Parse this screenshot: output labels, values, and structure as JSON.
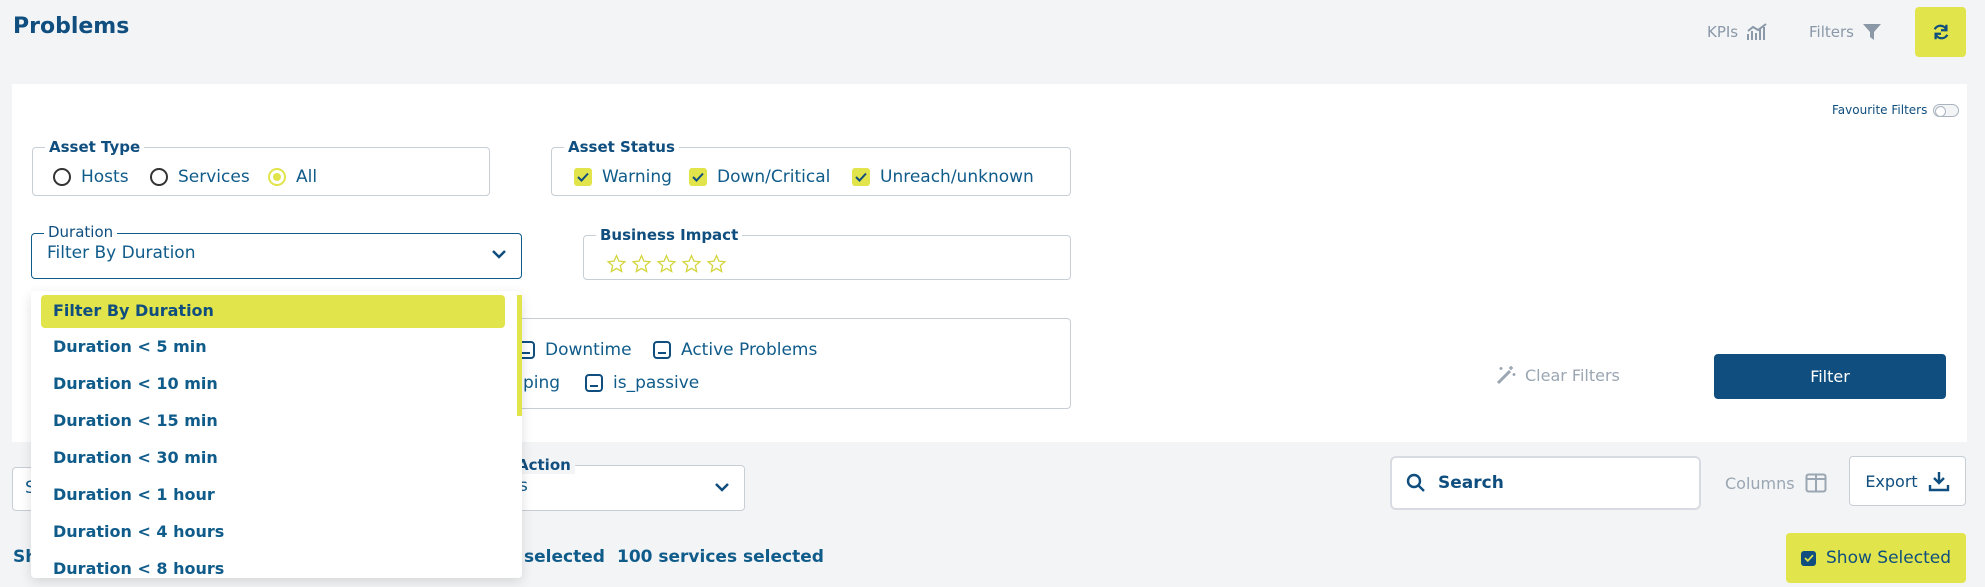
{
  "header": {
    "title": "Problems",
    "kpis_label": "KPIs",
    "filters_label": "Filters"
  },
  "panel": {
    "favourite_filters_label": "Favourite Filters",
    "asset_type": {
      "legend": "Asset Type",
      "options": [
        "Hosts",
        "Services",
        "All"
      ],
      "selected": "All"
    },
    "asset_status": {
      "legend": "Asset Status",
      "options": [
        "Warning",
        "Down/Critical",
        "Unreach/unknown"
      ]
    },
    "duration": {
      "label": "Duration",
      "value": "Filter By Duration"
    },
    "business_impact": {
      "legend": "Business Impact",
      "stars": 5
    },
    "checks": {
      "row1": [
        "Downtime",
        "Active Problems"
      ],
      "row2_partial": "ping",
      "row2": [
        "is_passive"
      ]
    },
    "clear_filters_label": "Clear Filters",
    "filter_button_label": "Filter"
  },
  "toolbar": {
    "left_select_partial": "S",
    "action": {
      "label": "Action",
      "value_partial": "s"
    },
    "search_placeholder": "Search",
    "columns_label": "Columns",
    "export_label": "Export"
  },
  "footer": {
    "show_partial": "Sh",
    "hosts_selected_partial": "selected",
    "services_selected": "100 services selected",
    "show_selected_label": "Show Selected"
  },
  "dropdown": {
    "items": [
      "Filter By Duration",
      "Duration < 5 min",
      "Duration < 10 min",
      "Duration < 15 min",
      "Duration < 30 min",
      "Duration < 1 hour",
      "Duration < 4 hours",
      "Duration < 8 hours"
    ],
    "selected_index": 0
  },
  "colors": {
    "accent": "#e1e44a",
    "primary": "#0f4e7e",
    "text": "#0f5b8a",
    "muted": "#9aa6b2",
    "background": "#f3f4f6"
  },
  "icons": {
    "kpis": "chart-line-icon",
    "filters": "funnel-icon",
    "refresh": "refresh-icon",
    "clear_filters": "magic-wand-icon",
    "search": "search-icon",
    "columns": "columns-icon",
    "export": "download-icon"
  }
}
